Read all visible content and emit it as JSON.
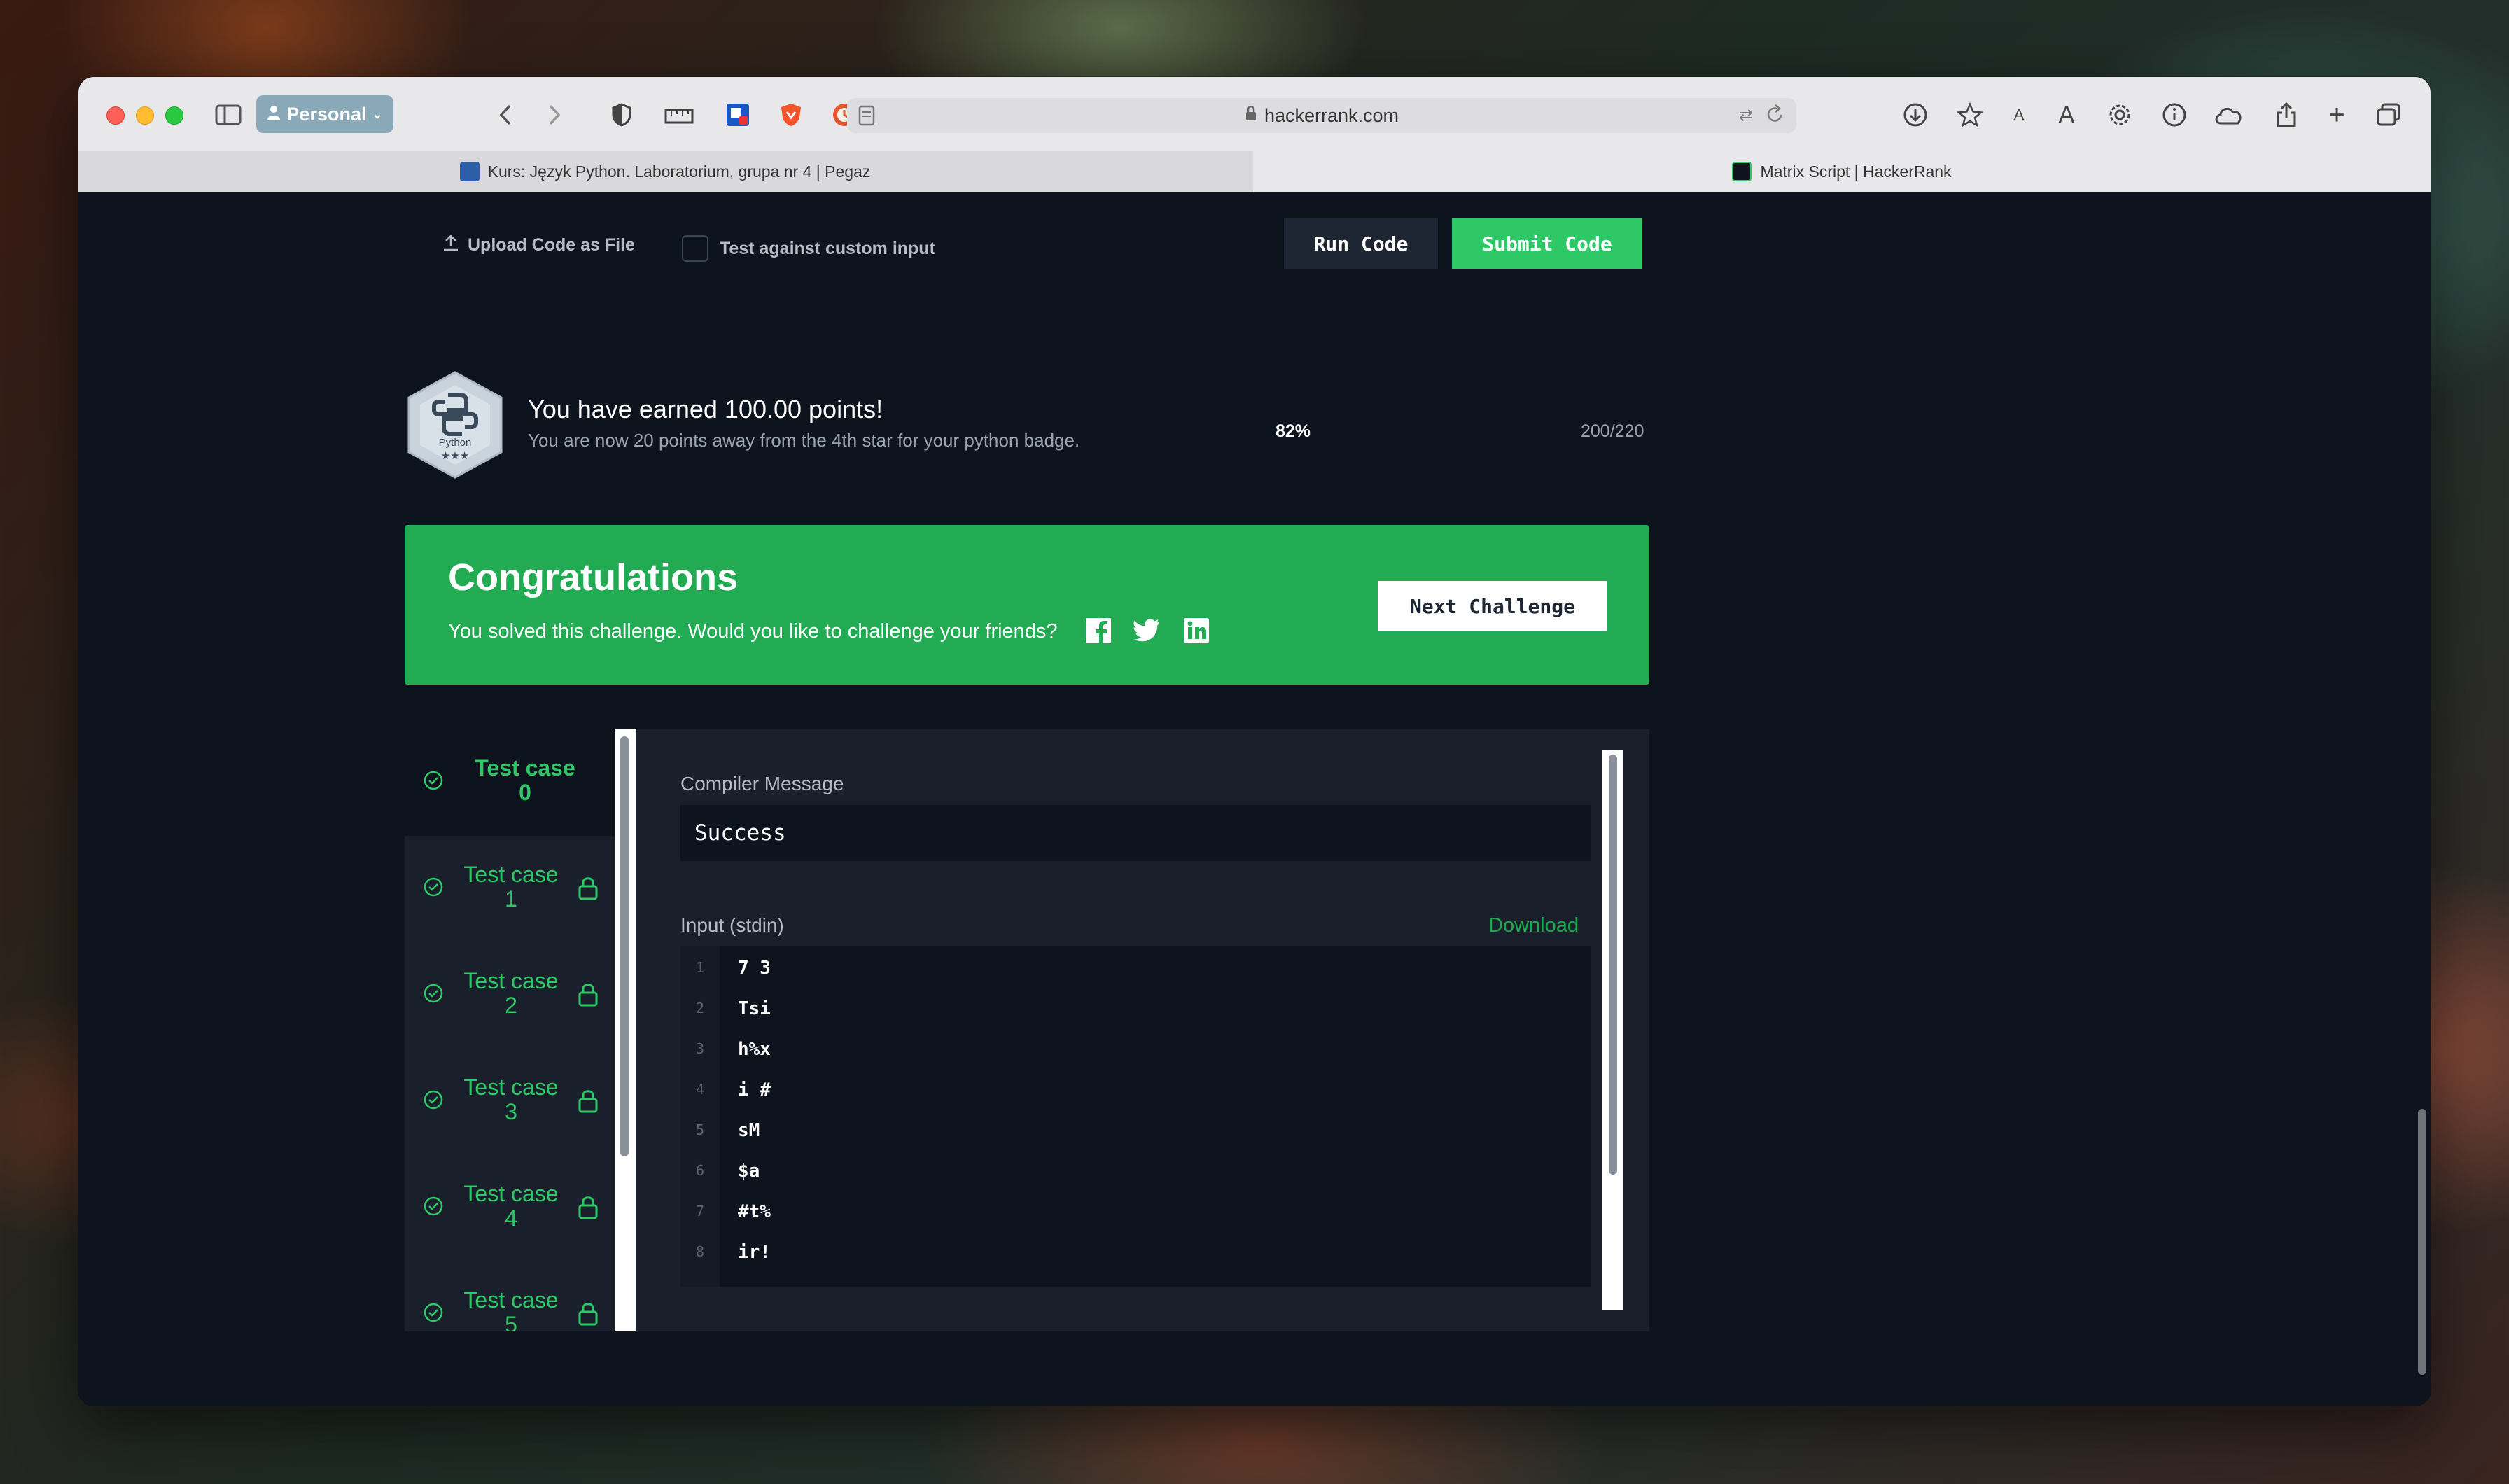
{
  "browser": {
    "profile_label": "Personal",
    "url": "hackerrank.com",
    "tabs": [
      {
        "title": "Kurs: Język Python. Laboratorium, grupa nr 4 | Pegaz"
      },
      {
        "title": "Matrix Script | HackerRank"
      }
    ]
  },
  "editor_actions": {
    "upload_label": "Upload Code as File",
    "custom_input_label": "Test against custom input",
    "run_label": "Run Code",
    "submit_label": "Submit Code"
  },
  "points": {
    "badge_text": "Python",
    "badge_stars": "★★★",
    "title": "You have earned 100.00 points!",
    "subtitle": "You are now 20 points away from the 4th star for your python badge.",
    "percent": "82%",
    "fraction": "200/220"
  },
  "congrats": {
    "heading": "Congratulations",
    "message": "You solved this challenge. Would you like to challenge your friends?",
    "next_label": "Next Challenge"
  },
  "test_cases": [
    {
      "title": "Test case",
      "num": "0",
      "locked": false,
      "active": true
    },
    {
      "title": "Test case",
      "num": "1",
      "locked": true,
      "active": false
    },
    {
      "title": "Test case",
      "num": "2",
      "locked": true,
      "active": false
    },
    {
      "title": "Test case",
      "num": "3",
      "locked": true,
      "active": false
    },
    {
      "title": "Test case",
      "num": "4",
      "locked": true,
      "active": false
    },
    {
      "title": "Test case",
      "num": "5",
      "locked": true,
      "active": false
    }
  ],
  "result": {
    "compiler_label": "Compiler Message",
    "compiler_message": "Success",
    "input_label": "Input (stdin)",
    "download_label": "Download",
    "input_lines": [
      {
        "n": "1",
        "text": "7 3"
      },
      {
        "n": "2",
        "text": "Tsi"
      },
      {
        "n": "3",
        "text": "h%x"
      },
      {
        "n": "4",
        "text": "i #"
      },
      {
        "n": "5",
        "text": "sM"
      },
      {
        "n": "6",
        "text": "$a"
      },
      {
        "n": "7",
        "text": "#t%"
      },
      {
        "n": "8",
        "text": "ir!"
      }
    ]
  },
  "colors": {
    "accent_green": "#2ec866",
    "congrats_green": "#22ab52",
    "page_bg": "#0e141e"
  }
}
